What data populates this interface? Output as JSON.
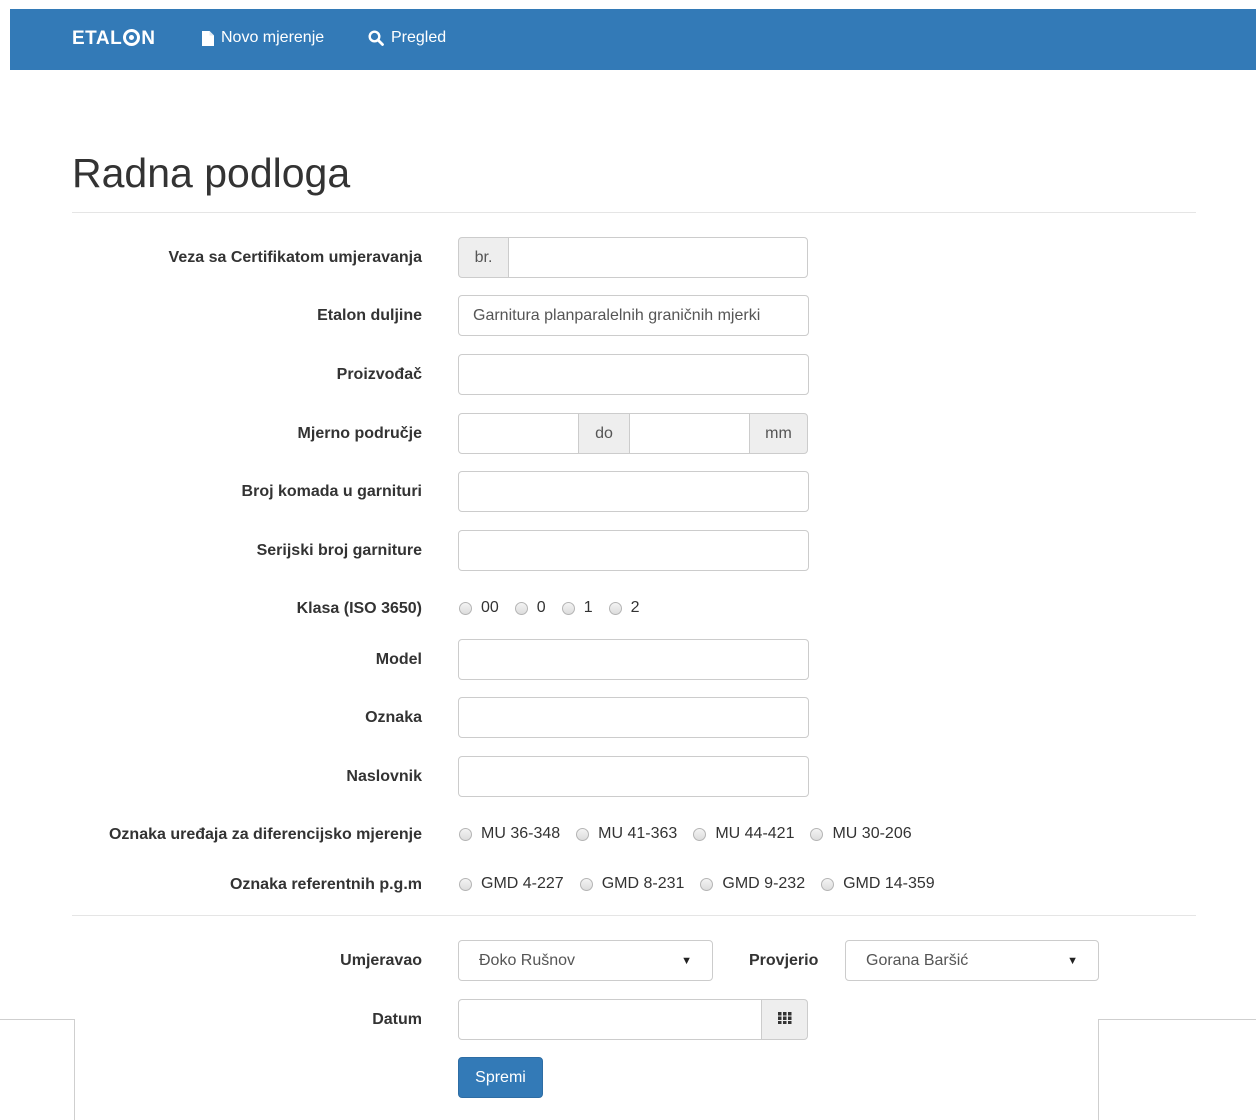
{
  "navbar": {
    "brand_prefix": "ETAL",
    "brand_suffix": "N",
    "links": [
      {
        "label": "Novo mjerenje",
        "icon": "file-icon"
      },
      {
        "label": "Pregled",
        "icon": "search-icon"
      }
    ]
  },
  "page": {
    "title": "Radna podloga"
  },
  "form": {
    "certificate": {
      "label": "Veza sa Certifikatom umjeravanja",
      "addon": "br.",
      "value": ""
    },
    "etalon": {
      "label": "Etalon duljine",
      "value": "Garnitura planparalelnih graničnih mjerki"
    },
    "manufacturer": {
      "label": "Proizvođač",
      "value": ""
    },
    "range": {
      "label": "Mjerno područje",
      "from": "",
      "sep": "do",
      "to": "",
      "unit": "mm"
    },
    "pieces": {
      "label": "Broj komada u garnituri",
      "value": ""
    },
    "serial": {
      "label": "Serijski broj garniture",
      "value": ""
    },
    "klasa": {
      "label": "Klasa (ISO 3650)",
      "options": [
        "00",
        "0",
        "1",
        "2"
      ]
    },
    "model": {
      "label": "Model",
      "value": ""
    },
    "oznaka": {
      "label": "Oznaka",
      "value": ""
    },
    "naslovnik": {
      "label": "Naslovnik",
      "value": ""
    },
    "device": {
      "label": "Oznaka uređaja za diferencijsko mjerenje",
      "options": [
        "MU 36-348",
        "MU 41-363",
        "MU 44-421",
        "MU 30-206"
      ]
    },
    "reference": {
      "label": "Oznaka referentnih p.g.m",
      "options": [
        "GMD 4-227",
        "GMD 8-231",
        "GMD 9-232",
        "GMD 14-359"
      ]
    },
    "umjeravao": {
      "label": "Umjeravao",
      "selected": "Đoko Rušnov"
    },
    "provjerio": {
      "label": "Provjerio",
      "selected": "Gorana Baršić"
    },
    "datum": {
      "label": "Datum",
      "value": ""
    },
    "submit_label": "Spremi"
  },
  "colors": {
    "navbar": "#337ab7",
    "primary": "#337ab7"
  }
}
